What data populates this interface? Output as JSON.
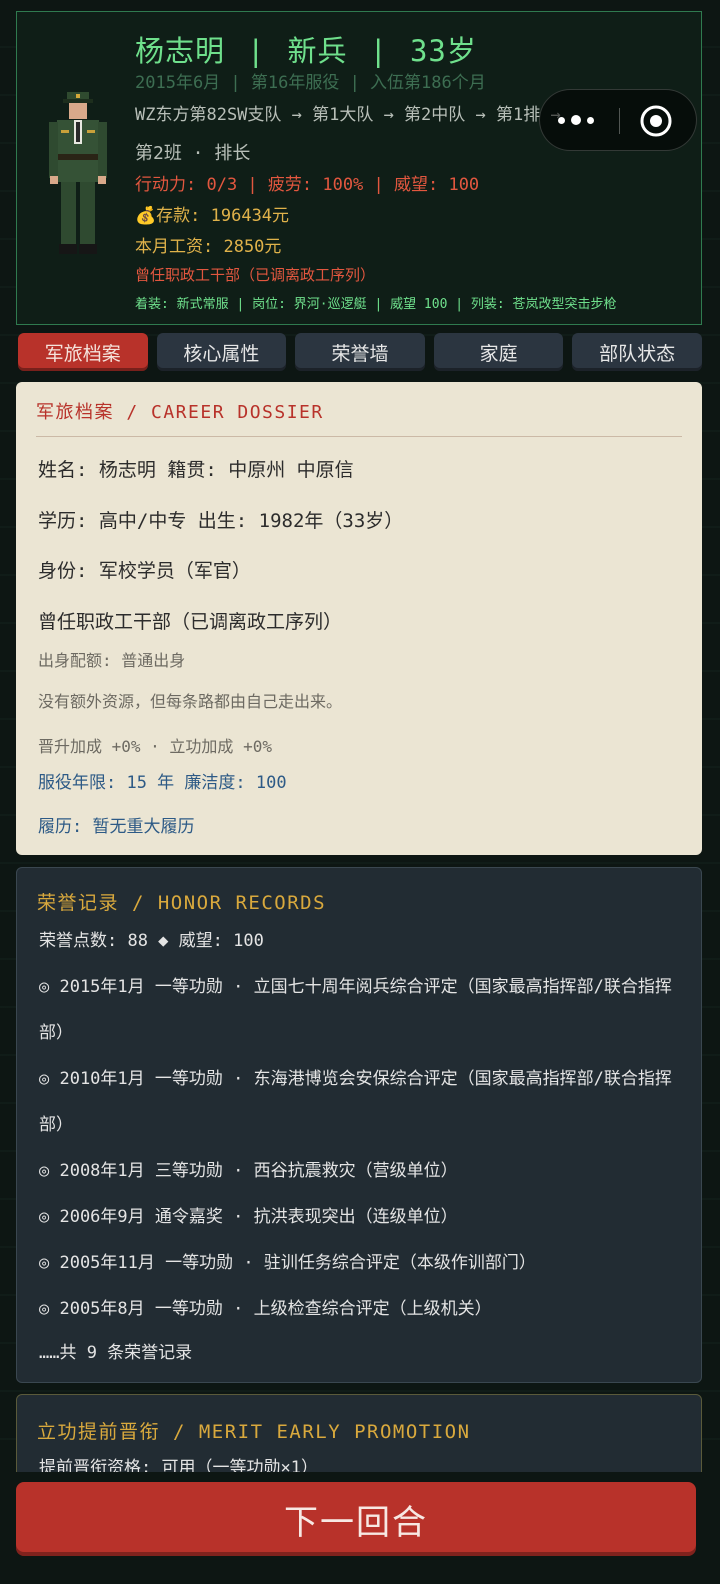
{
  "header": {
    "name": "杨志明",
    "rank": "新兵",
    "age": "33岁",
    "sep": "|",
    "service_line": "2015年6月 | 第16年服役 | 入伍第186个月",
    "unit_path": "WZ东方第82SW支队 → 第1大队 → 第2中队 → 第1排 →",
    "squad_role": "第2班 · 排长",
    "stats": "行动力: 0/3 | 疲劳: 100% | 威望: 100",
    "savings": "💰存款: 196434元",
    "salary": "本月工资: 2850元",
    "former_post": "曾任职政工干部（已调离政工序列）",
    "equipment": "着装: 新式常服 | 岗位: 界河·巡逻艇 | 威望 100 | 列装: 苍岚改型突击步枪"
  },
  "capsule": {
    "more_icon": "more-dots-icon",
    "target_icon": "target-icon"
  },
  "tabs": [
    "军旅档案",
    "核心属性",
    "荣誉墙",
    "家庭",
    "部队状态"
  ],
  "dossier": {
    "title": "军旅档案 / CAREER DOSSIER",
    "name_line": "姓名: 杨志明     籍贯: 中原州 中原信",
    "edu_line": "学历: 高中/中专      出生: 1982年（33岁）",
    "identity": "身份: 军校学员（军官）",
    "former": "曾任职政工干部（已调离政工序列）",
    "background": "出身配额: 普通出身",
    "motto": "没有额外资源，但每条路都由自己走出来。",
    "bonus": "晋升加成 +0% · 立功加成 +0%",
    "years": "服役年限: 15 年  廉洁度: 100",
    "record": "履历: 暂无重大履历"
  },
  "honor": {
    "title": "荣誉记录 / HONOR RECORDS",
    "summary": "荣誉点数: 88 ◆  威望: 100",
    "items": [
      "◎ 2015年1月 一等功勋 · 立国七十周年阅兵综合评定（国家最高指挥部/联合指挥部）",
      "◎ 2010年1月 一等功勋 · 东海港博览会安保综合评定（国家最高指挥部/联合指挥部）",
      "◎ 2008年1月 三等功勋 · 西谷抗震救灾（营级单位）",
      "◎ 2006年9月 通令嘉奖 · 抗洪表现突出（连级单位）",
      "◎ 2005年11月 一等功勋 · 驻训任务综合评定（本级作训部门）",
      "◎ 2005年8月 一等功勋 · 上级检查综合评定（上级机关）"
    ],
    "more": "……共 9 条荣誉记录"
  },
  "merit": {
    "title": "立功提前晋衔 / MERIT EARLY PROMOTION",
    "line": "提前晋衔资格: 可用（一等功勋×1）"
  },
  "next_button": "下一回合"
}
